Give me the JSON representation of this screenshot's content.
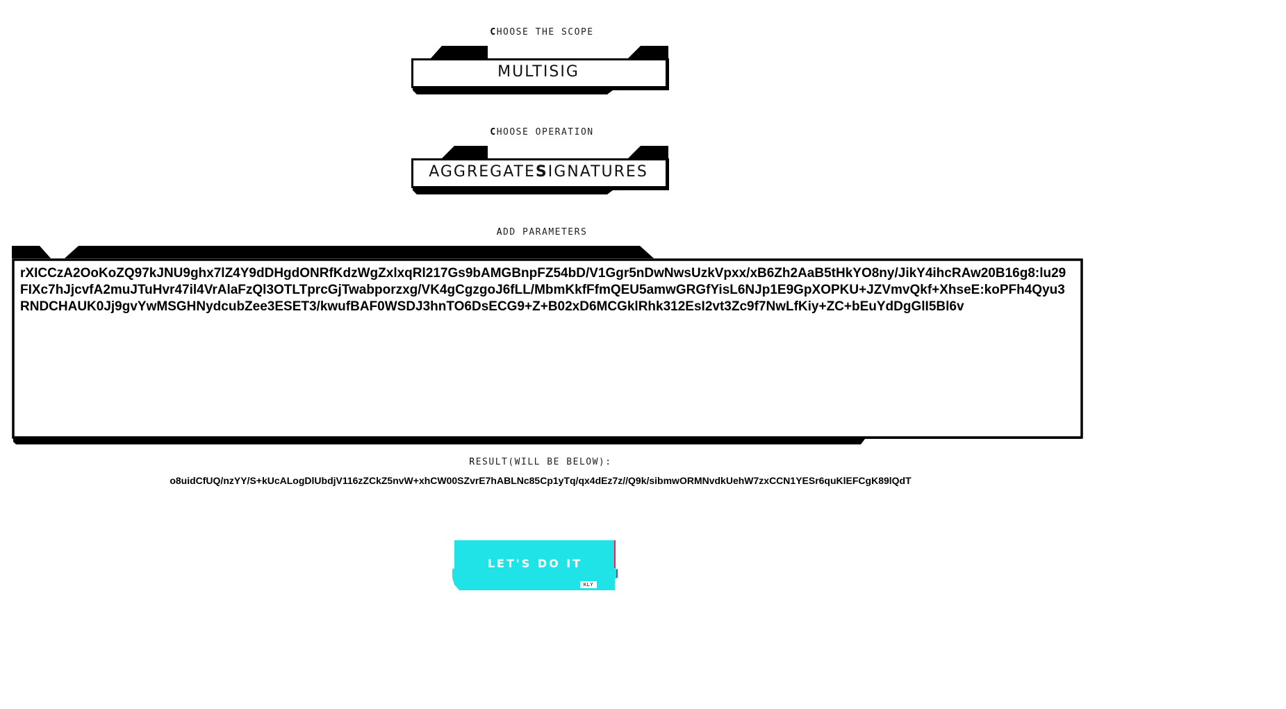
{
  "scope": {
    "label_first": "C",
    "label_rest": "HOOSE THE SCOPE",
    "value": "MULTISIG"
  },
  "operation": {
    "label_first": "C",
    "label_rest": "HOOSE OPERATION",
    "value_part1": "AGGREGATE",
    "value_highlight": "S",
    "value_part2": "IGNATURES"
  },
  "parameters": {
    "label_first": "A",
    "label_rest": "DD PARAMETERS",
    "value": "rXICCzA2OoKoZQ97kJNU9ghx7lZ4Y9dDHgdONRfKdzWgZxlxqRl217Gs9bAMGBnpFZ54bD/V1Ggr5nDwNwsUzkVpxx/xB6Zh2AaB5tHkYO8ny/JikY4ihcRAw20B16g8:lu29FIXc7hJjcvfA2muJTuHvr47il4VrAlaFzQl3OTLTprcGjTwabporzxg/VK4gCgzgoJ6fLL/MbmKkfFfmQEU5amwGRGfYisL6NJp1E9GpXOPKU+JZVmvQkf+XhseE:koPFh4Qyu3RNDCHAUK0Jj9gvYwMSGHNydcubZee3ESET3/kwufBAF0WSDJ3hnTO6DsECG9+Z+B02xD6MCGklRhk312EsI2vt3Zc9f7NwLfKiy+ZC+bEuYdDgGlI5Bl6v"
  },
  "result": {
    "label_first": "R",
    "label_rest": "ESULT(WILL BE BELOW):",
    "value": "o8uidCfUQ/nzYY/S+kUcALogDlUbdjV116zZCkZ5nvW+xhCW00SZvrE7hABLNc85Cp1yTq/qx4dEz7z//Q9k/sibmwORMNvdkUehW7zxCCN1YESr6quKlEFCgK89lQdT"
  },
  "action": {
    "button_label": "LET'S DO IT",
    "tag": "KLY"
  },
  "colors": {
    "frame": "#000000",
    "button": "#1fe3e6",
    "button_accent_left": "#00b8c4",
    "button_accent_right": "#e0245e"
  },
  "icons": {
    "select_frame": "notched-frame",
    "params_frame": "notched-frame"
  }
}
